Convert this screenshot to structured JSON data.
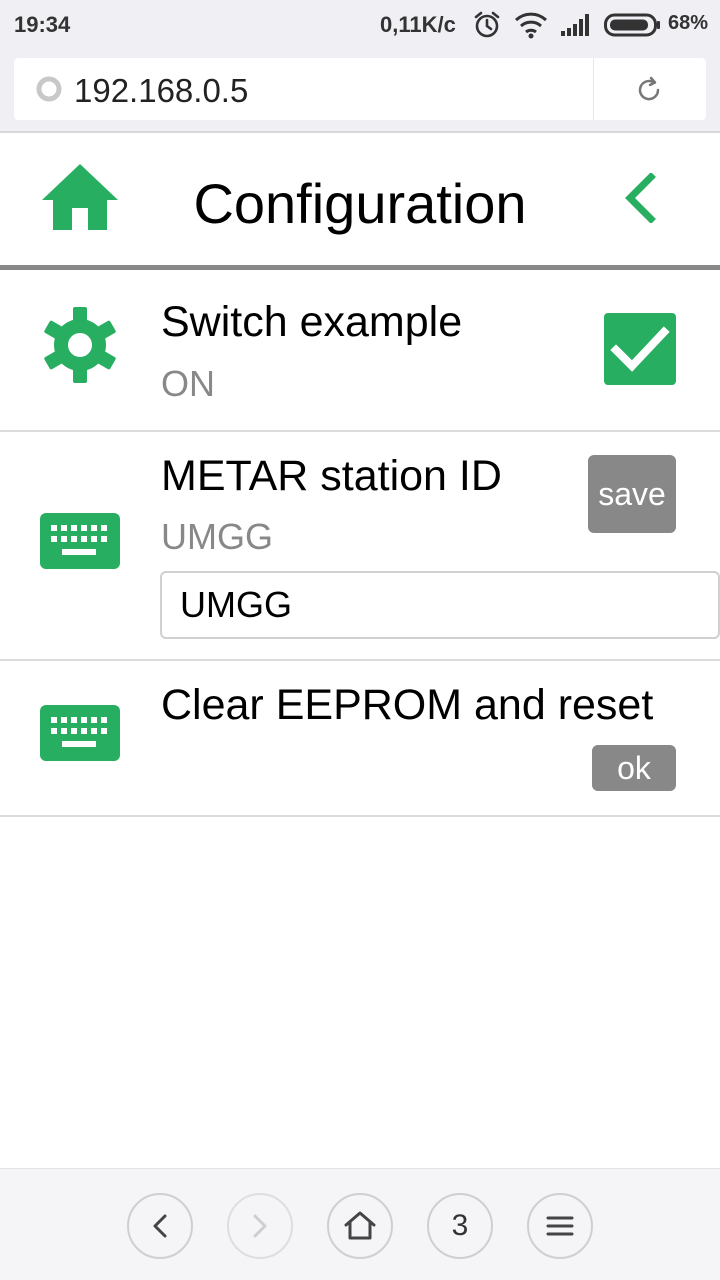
{
  "status_bar": {
    "time": "19:34",
    "net_speed": "0,11K/c",
    "battery": "68%"
  },
  "address_bar": {
    "url": "192.168.0.5"
  },
  "header": {
    "title": "Configuration"
  },
  "items": [
    {
      "title": "Switch example",
      "value": "ON",
      "icon": "gear-icon",
      "control": "checkbox",
      "checked": true
    },
    {
      "title": "METAR station ID",
      "value": "UMGG",
      "icon": "keyboard-icon",
      "input_value": "UMGG",
      "button": "save"
    },
    {
      "title": "Clear EEPROM and reset",
      "icon": "keyboard-icon",
      "button": "ok"
    }
  ],
  "browser_nav": {
    "tab_count": "3"
  },
  "colors": {
    "accent": "#27ae60",
    "button_gray": "#888888",
    "subtext": "#888888"
  }
}
